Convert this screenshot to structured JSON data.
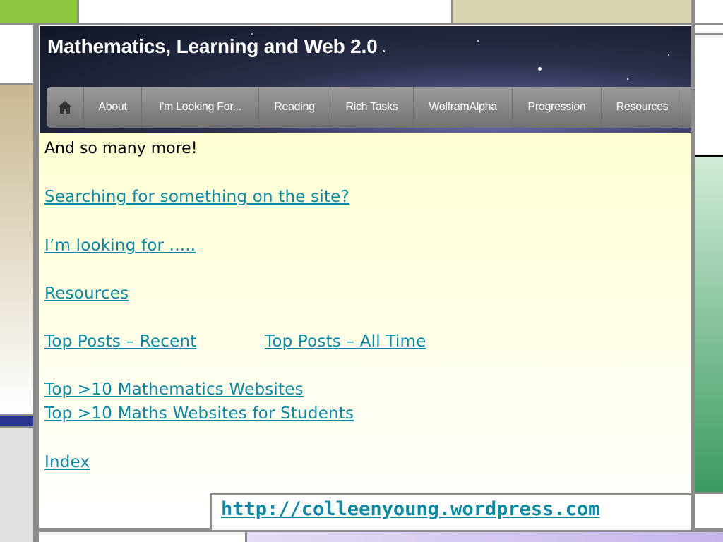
{
  "header": {
    "title": "Mathematics, Learning and Web 2.0"
  },
  "nav": {
    "home_icon": "home-icon",
    "items": [
      {
        "label": "About"
      },
      {
        "label": "I'm Looking For..."
      },
      {
        "label": "Reading"
      },
      {
        "label": "Rich Tasks"
      },
      {
        "label": "WolframAlpha"
      },
      {
        "label": "Progression"
      },
      {
        "label": "Resources"
      }
    ]
  },
  "content": {
    "intro": "And so many more!",
    "links": {
      "searching": "Searching for something on the site?",
      "looking_for": "I’m looking for .....",
      "resources": "Resources",
      "top_recent": "Top Posts – Recent",
      "top_all_time": "Top Posts – All Time",
      "top_math_sites": "Top >10 Mathematics Websites",
      "top_student_sites": "Top >10 Maths Websites for Students",
      "index": "Index"
    }
  },
  "footer": {
    "url": "http://colleenyoung.wordpress.com"
  },
  "colors": {
    "link": "#0b8aa6",
    "frame_gray": "#8c8c8c",
    "accent_green": "#8dc63f",
    "accent_olive": "#d8d4b0",
    "accent_navy": "#2a3590",
    "accent_tan": "#c8b890",
    "accent_mint": "#3a9a60"
  }
}
